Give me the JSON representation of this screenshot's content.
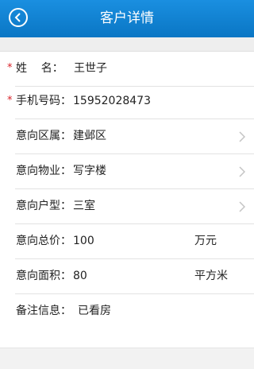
{
  "header": {
    "title": "客户详情",
    "back_icon": "back-circle-icon"
  },
  "fields": {
    "name": {
      "label": "姓    名：",
      "value": "王世子",
      "required": "*"
    },
    "phone": {
      "label": "手机号码：",
      "value": "15952028473",
      "required": "*"
    },
    "district": {
      "label": "意向区属：",
      "value": "建邺区"
    },
    "property": {
      "label": "意向物业：",
      "value": "写字楼"
    },
    "layout": {
      "label": "意向户型：",
      "value": "三室"
    },
    "price": {
      "label": "意向总价：",
      "value": "100",
      "unit": "万元"
    },
    "area": {
      "label": "意向面积：",
      "value": "80",
      "unit": "平方米"
    },
    "notes": {
      "label": "备注信息：",
      "value": "已看房"
    }
  },
  "colors": {
    "header": "#0a76c4",
    "required": "#d81f26"
  }
}
